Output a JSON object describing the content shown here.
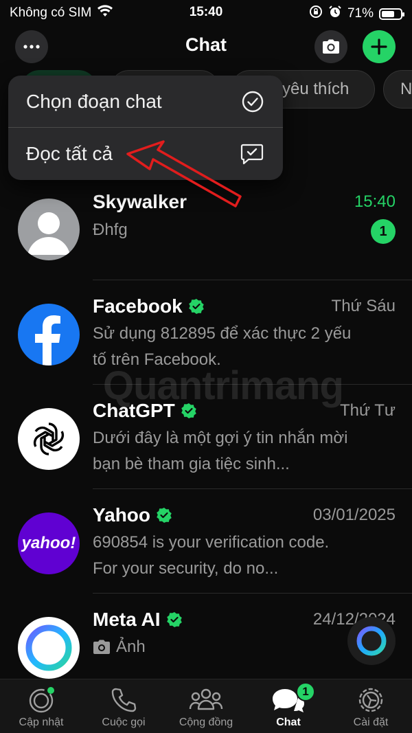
{
  "status_bar": {
    "carrier": "Không có SIM",
    "time": "15:40",
    "battery": "71%",
    "battery_level": 0.71
  },
  "header": {
    "title": "Chat"
  },
  "filters": {
    "chips": [
      "",
      "",
      "yêu thích",
      "N"
    ]
  },
  "menu": {
    "items": [
      {
        "label": "Chọn đoạn chat",
        "icon": "check-circle-icon"
      },
      {
        "label": "Đọc tất cả",
        "icon": "message-check-icon"
      }
    ]
  },
  "chats": [
    {
      "name": "Skywalker",
      "verified": false,
      "time": "15:40",
      "time_color": "#25d366",
      "preview": "Đhfg",
      "unread": "1"
    },
    {
      "name": "Facebook",
      "verified": true,
      "time": "Thứ Sáu",
      "preview": "Sử dụng 812895 để xác thực 2 yếu tố trên Facebook."
    },
    {
      "name": "ChatGPT",
      "verified": true,
      "time": "Thứ Tư",
      "preview": "Dưới đây là một gợi ý tin nhắn mời bạn bè tham gia tiệc sinh..."
    },
    {
      "name": "Yahoo",
      "verified": true,
      "time": "03/01/2025",
      "preview": "690854 is your verification code. For your security, do no...",
      "avatar_text": "yahoo!"
    },
    {
      "name": "Meta AI",
      "verified": true,
      "time": "24/12/2024",
      "preview": "Ảnh"
    }
  ],
  "watermark": "Quantrimang",
  "tabs": [
    {
      "label": "Cập nhật",
      "icon": "updates-icon"
    },
    {
      "label": "Cuộc gọi",
      "icon": "phone-icon"
    },
    {
      "label": "Cộng đồng",
      "icon": "community-icon"
    },
    {
      "label": "Chat",
      "icon": "chat-icon",
      "badge": "1",
      "active": true
    },
    {
      "label": "Cài đặt",
      "icon": "settings-icon"
    }
  ],
  "colors": {
    "accent": "#25d366",
    "background": "#0b0b0b",
    "menu": "#2a2a2c",
    "annotation_arrow": "#e11d1d"
  }
}
